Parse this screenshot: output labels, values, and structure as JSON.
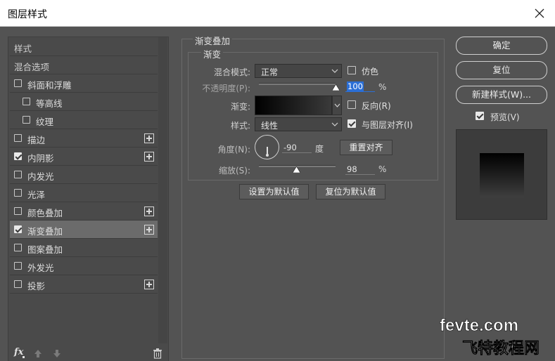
{
  "window": {
    "title": "图层样式",
    "close_icon": "close-icon"
  },
  "left": {
    "items": [
      {
        "label": "样式",
        "checkbox": false,
        "checked": false,
        "plus": false,
        "indent": 0,
        "header": true,
        "selected": false
      },
      {
        "label": "混合选项",
        "checkbox": false,
        "checked": false,
        "plus": false,
        "indent": 0,
        "header": true,
        "selected": false
      },
      {
        "label": "斜面和浮雕",
        "checkbox": true,
        "checked": false,
        "plus": false,
        "indent": 0,
        "header": false,
        "selected": false
      },
      {
        "label": "等高线",
        "checkbox": true,
        "checked": false,
        "plus": false,
        "indent": 1,
        "header": false,
        "selected": false
      },
      {
        "label": "纹理",
        "checkbox": true,
        "checked": false,
        "plus": false,
        "indent": 1,
        "header": false,
        "selected": false
      },
      {
        "label": "描边",
        "checkbox": true,
        "checked": false,
        "plus": true,
        "indent": 0,
        "header": false,
        "selected": false
      },
      {
        "label": "内阴影",
        "checkbox": true,
        "checked": true,
        "plus": true,
        "indent": 0,
        "header": false,
        "selected": false
      },
      {
        "label": "内发光",
        "checkbox": true,
        "checked": false,
        "plus": false,
        "indent": 0,
        "header": false,
        "selected": false
      },
      {
        "label": "光泽",
        "checkbox": true,
        "checked": false,
        "plus": false,
        "indent": 0,
        "header": false,
        "selected": false
      },
      {
        "label": "颜色叠加",
        "checkbox": true,
        "checked": false,
        "plus": true,
        "indent": 0,
        "header": false,
        "selected": false
      },
      {
        "label": "渐变叠加",
        "checkbox": true,
        "checked": true,
        "plus": true,
        "indent": 0,
        "header": false,
        "selected": true
      },
      {
        "label": "图案叠加",
        "checkbox": true,
        "checked": false,
        "plus": false,
        "indent": 0,
        "header": false,
        "selected": false
      },
      {
        "label": "外发光",
        "checkbox": true,
        "checked": false,
        "plus": false,
        "indent": 0,
        "header": false,
        "selected": false
      },
      {
        "label": "投影",
        "checkbox": true,
        "checked": false,
        "plus": true,
        "indent": 0,
        "header": false,
        "selected": false
      }
    ],
    "fx_label": "fx",
    "icons": [
      "fx-icon",
      "move-up-icon",
      "move-down-icon",
      "trash-icon"
    ]
  },
  "gradient_overlay": {
    "group_title": "渐变叠加",
    "subgroup_title": "渐变",
    "blend_mode_label": "混合模式:",
    "blend_mode_value": "正常",
    "dither_label": "仿色",
    "dither_checked": false,
    "opacity_label": "不透明度(P):",
    "opacity_value": "100",
    "opacity_fraction": 1.0,
    "opacity_unit": "%",
    "gradient_label": "渐变:",
    "gradient_colors": [
      "#000000",
      "#3a3a3a"
    ],
    "reverse_label": "反向(R)",
    "reverse_checked": false,
    "style_label": "样式:",
    "style_value": "线性",
    "align_label": "与图层对齐(I)",
    "align_checked": true,
    "angle_label": "角度(N):",
    "angle_value": "-90",
    "angle_degrees": -90,
    "angle_unit": "度",
    "reset_align_label": "重置对齐",
    "scale_label": "缩放(S):",
    "scale_value": "98",
    "scale_fraction": 0.49,
    "scale_unit": "%",
    "make_default_label": "设置为默认值",
    "reset_default_label": "复位为默认值"
  },
  "right": {
    "ok_label": "确定",
    "reset_label": "复位",
    "new_style_label": "新建样式(W)...",
    "preview_label": "预览(V)",
    "preview_checked": true
  },
  "watermark": {
    "top": "fevte.com",
    "bottom": "飞特教程网"
  },
  "colors": {
    "dialog_bg": "#535353",
    "selected_row": "#6b6b6b",
    "focus_blue": "#2b6fd6"
  }
}
